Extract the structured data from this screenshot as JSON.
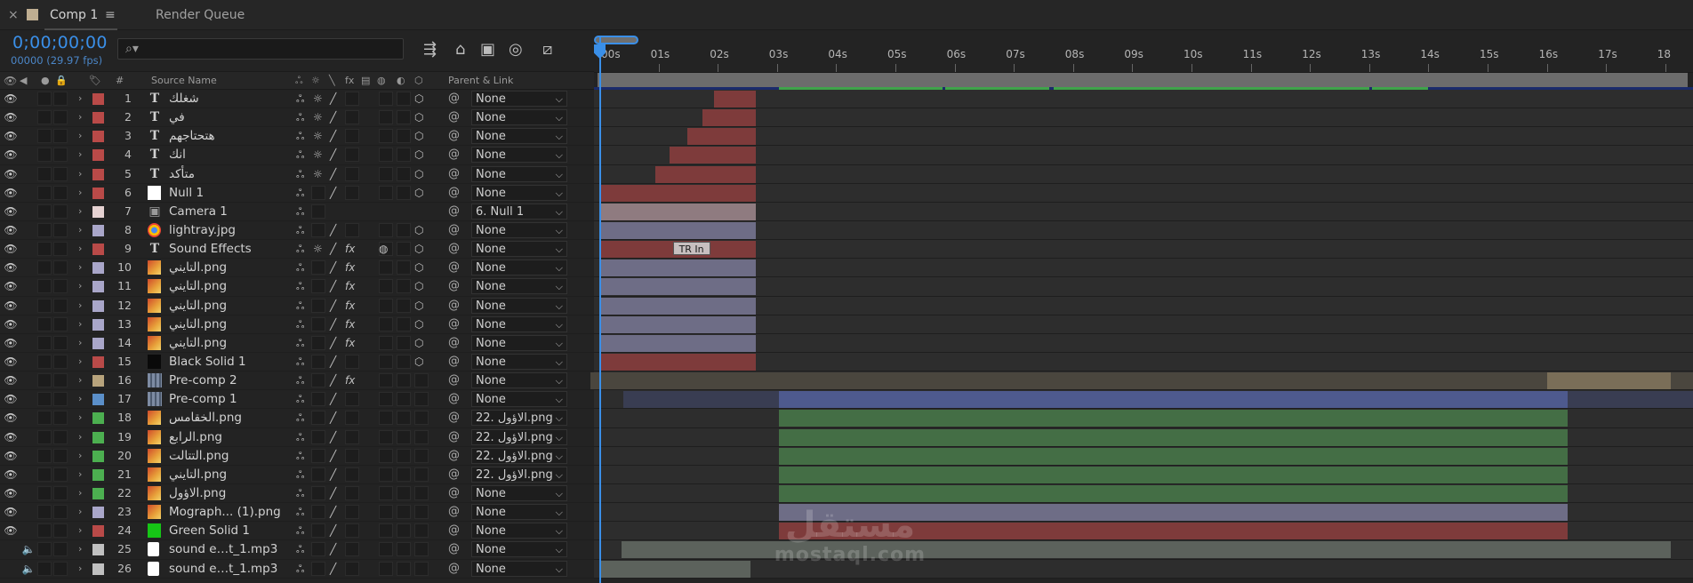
{
  "tabs": {
    "close": "×",
    "comp_label": "Comp 1",
    "comp_color": "#bfae91",
    "menu_icon": "≡",
    "render_queue": "Render Queue"
  },
  "header": {
    "timecode": "0;00;00;00",
    "fps": "00000 (29.97 fps)",
    "search_placeholder": "⌕▾"
  },
  "columns": {
    "source_name": "Source Name",
    "hash": "#",
    "parent_link": "Parent & Link",
    "fx": "fx"
  },
  "ruler": {
    "labels": [
      ":00s",
      "01s",
      "02s",
      "03s",
      "04s",
      "05s",
      "06s",
      "07s",
      "08s",
      "09s",
      "10s",
      "11s",
      "12s",
      "13s",
      "14s",
      "15s",
      "16s",
      "17s",
      "18"
    ]
  },
  "layers": [
    {
      "num": "1",
      "type": "T",
      "name": "شغلك",
      "color": "#b94a48",
      "parent": "None",
      "solo3d": true,
      "fx": false,
      "eye": "eye"
    },
    {
      "num": "2",
      "type": "T",
      "name": "في",
      "color": "#b94a48",
      "parent": "None",
      "solo3d": true,
      "fx": false,
      "eye": "eye"
    },
    {
      "num": "3",
      "type": "T",
      "name": "هتحتاجهم",
      "color": "#b94a48",
      "parent": "None",
      "solo3d": true,
      "fx": false,
      "eye": "eye"
    },
    {
      "num": "4",
      "type": "T",
      "name": "انك",
      "color": "#b94a48",
      "parent": "None",
      "solo3d": true,
      "fx": false,
      "eye": "eye"
    },
    {
      "num": "5",
      "type": "T",
      "name": "متأكد",
      "color": "#b94a48",
      "parent": "None",
      "solo3d": true,
      "fx": false,
      "eye": "eye"
    },
    {
      "num": "6",
      "type": "null",
      "name": "Null 1",
      "color": "#b94a48",
      "parent": "None",
      "solo3d": true,
      "fx": false,
      "eye": "eye"
    },
    {
      "num": "7",
      "type": "camera",
      "name": "Camera 1",
      "color": "#e5d2d2",
      "parent": "6. Null 1",
      "solo3d": false,
      "fx": false,
      "eye": "eye"
    },
    {
      "num": "8",
      "type": "chrome",
      "name": "lightray.jpg",
      "color": "#a9a6c9",
      "parent": "None",
      "solo3d": true,
      "fx": false,
      "eye": "eye"
    },
    {
      "num": "9",
      "type": "T",
      "name": "Sound  Effects",
      "color": "#b94a48",
      "parent": "None",
      "solo3d": true,
      "fx": true,
      "eye": "eye"
    },
    {
      "num": "10",
      "type": "img",
      "name": "التايني.png",
      "color": "#a9a6c9",
      "parent": "None",
      "solo3d": true,
      "fx": true,
      "eye": "eye"
    },
    {
      "num": "11",
      "type": "img",
      "name": "التايني.png",
      "color": "#a9a6c9",
      "parent": "None",
      "solo3d": true,
      "fx": true,
      "eye": "eye"
    },
    {
      "num": "12",
      "type": "img",
      "name": "التايني.png",
      "color": "#a9a6c9",
      "parent": "None",
      "solo3d": true,
      "fx": true,
      "eye": "eye"
    },
    {
      "num": "13",
      "type": "img",
      "name": "التايني.png",
      "color": "#a9a6c9",
      "parent": "None",
      "solo3d": true,
      "fx": true,
      "eye": "eye"
    },
    {
      "num": "14",
      "type": "img",
      "name": "التايني.png",
      "color": "#a9a6c9",
      "parent": "None",
      "solo3d": true,
      "fx": true,
      "eye": "eye"
    },
    {
      "num": "15",
      "type": "solid",
      "name": "Black Solid 1",
      "color": "#b94a48",
      "parent": "None",
      "solo3d": true,
      "fx": false,
      "eye": "eye"
    },
    {
      "num": "16",
      "type": "precomp",
      "name": "Pre-comp 2",
      "color": "#b7a37c",
      "parent": "None",
      "solo3d": false,
      "fx": true,
      "eye": "eye"
    },
    {
      "num": "17",
      "type": "precomp",
      "name": "Pre-comp 1",
      "color": "#5b8fc9",
      "parent": "None",
      "solo3d": false,
      "fx": false,
      "eye": "eye"
    },
    {
      "num": "18",
      "type": "img",
      "name": "الخقامس.png",
      "color": "#4caf50",
      "parent": "22. الاؤول.png",
      "solo3d": false,
      "fx": false,
      "eye": "eye"
    },
    {
      "num": "19",
      "type": "img",
      "name": "الرابع.png",
      "color": "#4caf50",
      "parent": "22. الاؤول.png",
      "solo3d": false,
      "fx": false,
      "eye": "eye"
    },
    {
      "num": "20",
      "type": "img",
      "name": "التتالت.png",
      "color": "#4caf50",
      "parent": "22. الاؤول.png",
      "solo3d": false,
      "fx": false,
      "eye": "eye"
    },
    {
      "num": "21",
      "type": "img",
      "name": "التايني.png",
      "color": "#4caf50",
      "parent": "22. الاؤول.png",
      "solo3d": false,
      "fx": false,
      "eye": "eye"
    },
    {
      "num": "22",
      "type": "img",
      "name": "الاؤول.png",
      "color": "#4caf50",
      "parent": "None",
      "solo3d": false,
      "fx": false,
      "eye": "eye"
    },
    {
      "num": "23",
      "type": "img",
      "name": "Mograph... (1).png",
      "color": "#a9a6c9",
      "parent": "None",
      "solo3d": false,
      "fx": false,
      "eye": "eye"
    },
    {
      "num": "24",
      "type": "green",
      "name": "Green Solid 1",
      "color": "#b94a48",
      "parent": "None",
      "solo3d": false,
      "fx": false,
      "eye": "eye"
    },
    {
      "num": "25",
      "type": "audio",
      "name": "sound e…t_1.mp3",
      "color": "#c0c0c0",
      "parent": "None",
      "solo3d": false,
      "fx": false,
      "eye": "speaker"
    },
    {
      "num": "26",
      "type": "audio",
      "name": "sound e…t_1.mp3",
      "color": "#c0c0c0",
      "parent": "None",
      "solo3d": false,
      "fx": false,
      "eye": "speaker"
    }
  ],
  "tracks": [
    {
      "start": 1.94,
      "end": 2.64,
      "color": "#7e3b3b"
    },
    {
      "start": 1.74,
      "end": 2.64,
      "color": "#7e3b3b"
    },
    {
      "start": 1.48,
      "end": 2.64,
      "color": "#7e3b3b"
    },
    {
      "start": 1.18,
      "end": 2.64,
      "color": "#7e3b3b"
    },
    {
      "start": 0.94,
      "end": 2.64,
      "color": "#7e3b3b"
    },
    {
      "start": 0.0,
      "end": 2.64,
      "color": "#7e3b3b"
    },
    {
      "start": 0.0,
      "end": 2.64,
      "color": "#8f7b80"
    },
    {
      "start": 0.0,
      "end": 2.64,
      "color": "#6e6d86"
    },
    {
      "start": 0.0,
      "end": 2.64,
      "color": "#7e3b3b",
      "marker": "TR In",
      "marker_at": 1.24
    },
    {
      "start": 0.0,
      "end": 2.64,
      "color": "#6e6d86"
    },
    {
      "start": 0.0,
      "end": 2.64,
      "color": "#6e6d86"
    },
    {
      "start": 0.0,
      "end": 2.64,
      "color": "#6e6d86"
    },
    {
      "start": 0.0,
      "end": 2.64,
      "color": "#6e6d86"
    },
    {
      "start": 0.0,
      "end": 2.64,
      "color": "#6e6d86"
    },
    {
      "start": 0.0,
      "end": 2.64,
      "color": "#7e3b3b"
    },
    {
      "start": 16.0,
      "end": 18.1,
      "color": "#7a6e58",
      "bg": "#4a463e",
      "bgstart": -0.15
    },
    {
      "start": 3.04,
      "end": 16.35,
      "color": "#4e5a8e",
      "bg": "#393d52",
      "bgstart": 0.4
    },
    {
      "start": 3.04,
      "end": 16.35,
      "color": "#446e45"
    },
    {
      "start": 3.04,
      "end": 16.35,
      "color": "#446e45"
    },
    {
      "start": 3.04,
      "end": 16.35,
      "color": "#446e45"
    },
    {
      "start": 3.04,
      "end": 16.35,
      "color": "#446e45"
    },
    {
      "start": 3.04,
      "end": 16.35,
      "color": "#446e45"
    },
    {
      "start": 3.04,
      "end": 16.35,
      "color": "#6e6d86"
    },
    {
      "start": 3.04,
      "end": 16.35,
      "color": "#7e3b3b"
    },
    {
      "start": 0.38,
      "end": 18.1,
      "color": "#5c625c"
    },
    {
      "start": 0.0,
      "end": 2.55,
      "color": "#5c625c"
    }
  ],
  "watermark": {
    "arabic": "مستقل",
    "latin": "mostaql.com"
  }
}
